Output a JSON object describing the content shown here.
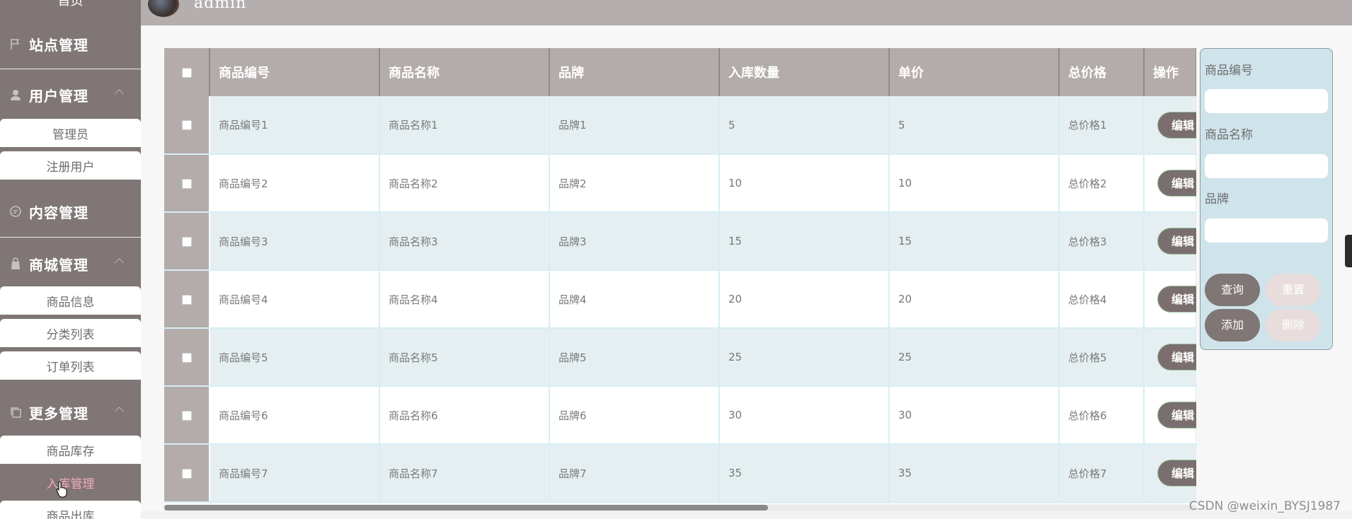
{
  "sidebar": {
    "home_label": "首页",
    "menus": [
      {
        "label": "站点管理",
        "icon": "flag-icon",
        "sub": []
      },
      {
        "label": "用户管理",
        "icon": "user-icon",
        "sub": [
          "管理员",
          "注册用户"
        ]
      },
      {
        "label": "内容管理",
        "icon": "chat-icon",
        "sub": []
      },
      {
        "label": "商城管理",
        "icon": "bag-icon",
        "sub": [
          "商品信息",
          "分类列表",
          "订单列表"
        ]
      },
      {
        "label": "更多管理",
        "icon": "copy-icon",
        "sub": [
          "商品库存",
          "入库管理",
          "商品出库"
        ]
      }
    ],
    "active_item": "入库管理"
  },
  "header": {
    "username": "admin"
  },
  "table": {
    "columns": [
      "商品编号",
      "商品名称",
      "品牌",
      "入库数量",
      "单价",
      "总价格",
      "操作"
    ],
    "rows": [
      [
        "商品编号1",
        "商品名称1",
        "品牌1",
        "5",
        "5",
        "总价格1"
      ],
      [
        "商品编号2",
        "商品名称2",
        "品牌2",
        "10",
        "10",
        "总价格2"
      ],
      [
        "商品编号3",
        "商品名称3",
        "品牌3",
        "15",
        "15",
        "总价格3"
      ],
      [
        "商品编号4",
        "商品名称4",
        "品牌4",
        "20",
        "20",
        "总价格4"
      ],
      [
        "商品编号5",
        "商品名称5",
        "品牌5",
        "25",
        "25",
        "总价格5"
      ],
      [
        "商品编号6",
        "商品名称6",
        "品牌6",
        "30",
        "30",
        "总价格6"
      ],
      [
        "商品编号7",
        "商品名称7",
        "品牌7",
        "35",
        "35",
        "总价格7"
      ]
    ],
    "edit_label": "编辑"
  },
  "search": {
    "label_code": "商品编号",
    "label_name": "商品名称",
    "label_brand": "品牌",
    "btn_query": "查询",
    "btn_reset": "重置",
    "btn_add": "添加",
    "btn_delete": "删除"
  },
  "watermark": "CSDN @weixin_BYSJ1987",
  "colors": {
    "sidebar_bg": "#7f7675",
    "header_bg": "#b5aeae",
    "table_head_bg": "#b4acab",
    "row_alt_bg": "#e5eff1",
    "search_panel_bg": "#cfe4ea",
    "active_text": "#f4a9c0"
  }
}
